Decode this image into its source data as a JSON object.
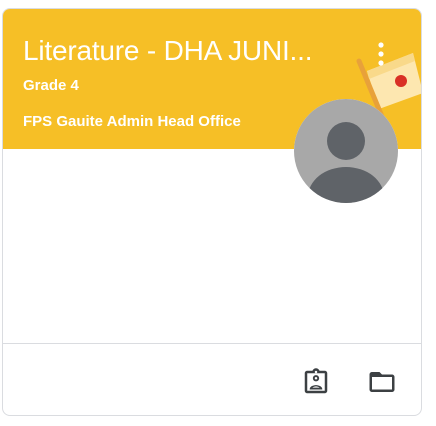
{
  "class_card": {
    "title": "Literature - DHA JUNI...",
    "section": "Grade 4",
    "owner": "FPS Gauite Admin Head Office",
    "header_color": "#f6bf26",
    "icons": {
      "more": "more-vert-icon",
      "avatar": "account-circle-icon",
      "work": "assignment-ind-icon",
      "folder": "folder-icon"
    }
  }
}
